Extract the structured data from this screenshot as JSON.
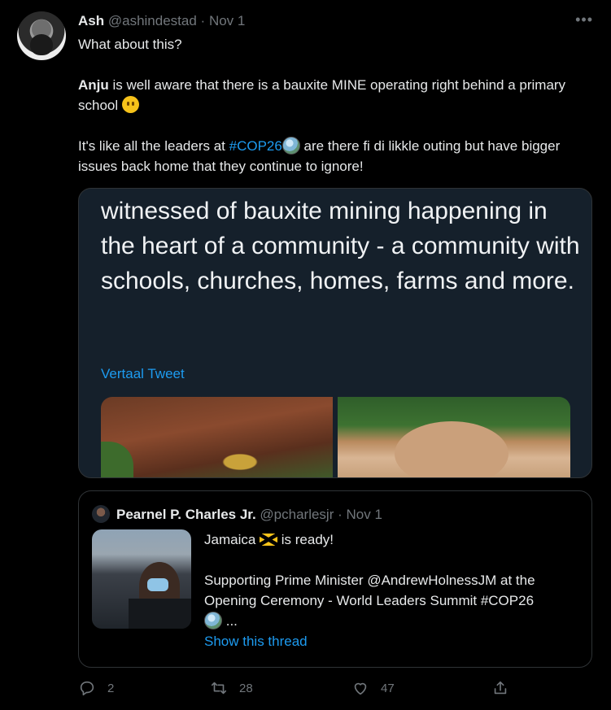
{
  "tweet": {
    "author_name": "Ash",
    "author_handle": "@ashindestad",
    "separator": "·",
    "date": "Nov 1",
    "more": "•••",
    "line1": "What about this?",
    "p2_bold": "Anju",
    "p2_rest": " is well aware that there is a bauxite MINE operating right behind a primary school ",
    "p3_before": "It's like all the leaders at ",
    "p3_hashtag": "#COP26",
    "p3_after": " are there fi di likkle outing but have bigger issues back home that they continue to ignore!"
  },
  "quote1": {
    "text": "witnessed of bauxite mining happening in the heart of a community - a community with schools, churches, homes, farms and more.",
    "translate_link": "Vertaal Tweet"
  },
  "quote2": {
    "author_name": "Pearnel P. Charles Jr.",
    "author_handle": "@pcharlesjr",
    "separator": "·",
    "date": "Nov 1",
    "line1": "Jamaica",
    "line1_after": " is ready!",
    "line2_prefix": "Supporting Prime Minister ",
    "line2_mention": "@AndrewHolnessJM",
    "line2_rest": " at the Opening Ceremony - World Leaders Summit ",
    "line2_hashtag": "#COP26",
    "ellipsis": " ...",
    "show_thread": "Show this thread"
  },
  "actions": {
    "replies": "2",
    "retweets": "28",
    "likes": "47"
  },
  "colors": {
    "background": "#000000",
    "link": "#1d9bf0",
    "muted": "#71767b",
    "card_bg": "#15202b"
  }
}
